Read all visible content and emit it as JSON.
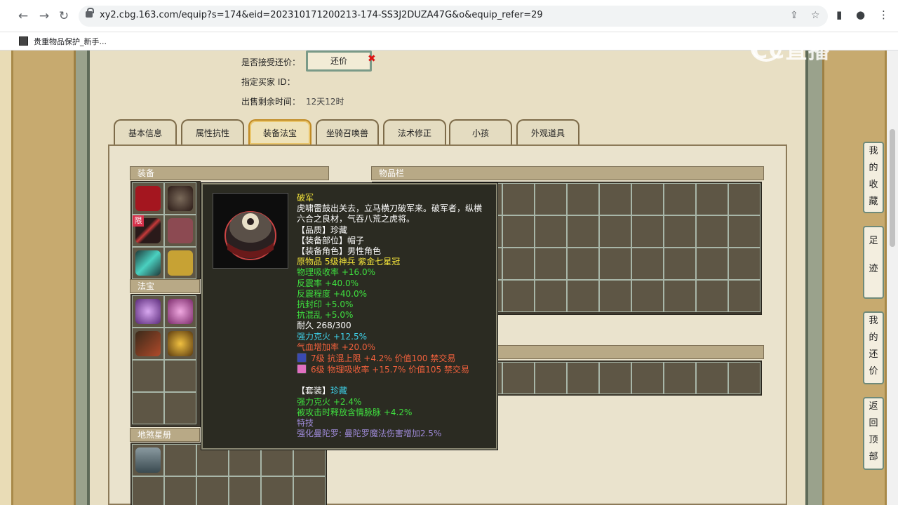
{
  "browser": {
    "url": "xy2.cbg.163.com/equip?s=174&eid=202310171200213-174-SS3J2DUZA47G&o&equip_refer=29",
    "bookmark": "贵重物品保护_新手..."
  },
  "watermark": "CC直播",
  "info": {
    "counter_label": "是否接受还价：",
    "counter_button": "还价",
    "buyer_label": "指定买家 ID：",
    "time_label": "出售剩余时间：",
    "time_value": "12天12时"
  },
  "tabs": [
    "基本信息",
    "属性抗性",
    "装备法宝",
    "坐骑召唤兽",
    "法术修正",
    "小孩",
    "外观道具"
  ],
  "active_tab": 2,
  "sections": {
    "equip": "装备",
    "fabao": "法宝",
    "disha": "地煞星册",
    "items": "物品栏"
  },
  "tooltip": {
    "name": "破军",
    "desc1": "虎啸雷鼓出关去，立马横刀破军来。破军者，纵横",
    "desc2": "六合之良材，气吞八荒之虎将。",
    "quality": "【品质】珍藏",
    "slot": "【装备部位】帽子",
    "role": "【装备角色】男性角色",
    "origin": "原物品 5级神兵 紫金七星冠",
    "attrs": [
      "物理吸收率 +16.0%",
      "反震率 +40.0%",
      "反震程度 +40.0%",
      "抗封印 +5.0%",
      "抗混乱 +5.0%",
      "耐久 268/300"
    ],
    "cyan_attr": "强力克火 +12.5%",
    "orange_attr": "气血增加率 +20.0%",
    "gem1": "7级 抗混上限 +4.2% 价值100 禁交易",
    "gem2": "6级 物理吸收率 +15.7% 价值105 禁交易",
    "set_title": "【套装】",
    "set_name": "珍藏",
    "set_attr1": "强力克火 +2.4%",
    "set_attr2": "被攻击时释放含情脉脉 +4.2%",
    "skill_label": "特技",
    "skill_desc": "强化曼陀罗: 曼陀罗魔法伤害增加2.5%"
  },
  "side_buttons": [
    "我的收藏",
    "足迹",
    "我的还价",
    "返回顶部"
  ],
  "limit_badge": "限"
}
